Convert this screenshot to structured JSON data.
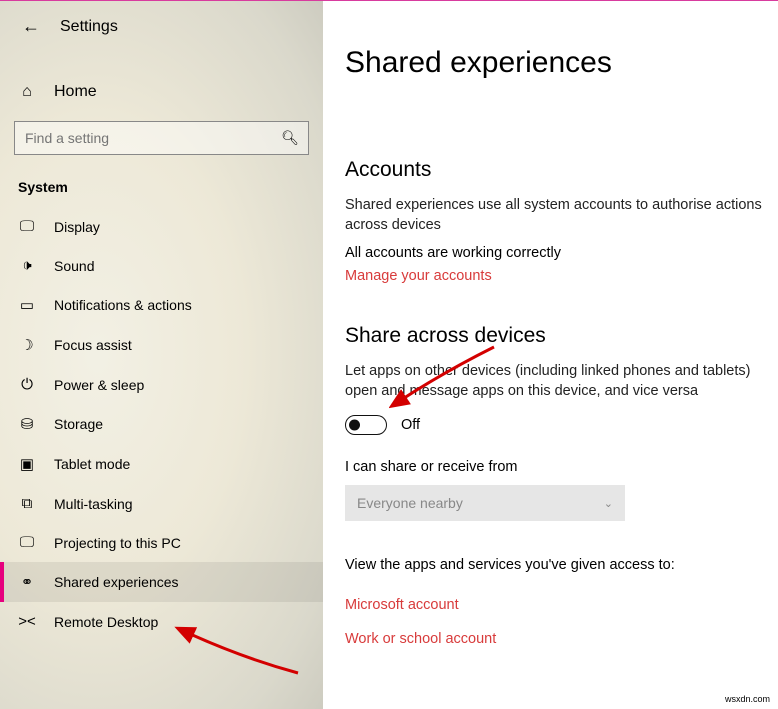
{
  "header": {
    "title": "Settings"
  },
  "home": {
    "label": "Home"
  },
  "search": {
    "placeholder": "Find a setting"
  },
  "section": "System",
  "nav": [
    {
      "label": "Display"
    },
    {
      "label": "Sound"
    },
    {
      "label": "Notifications & actions"
    },
    {
      "label": "Focus assist"
    },
    {
      "label": "Power & sleep"
    },
    {
      "label": "Storage"
    },
    {
      "label": "Tablet mode"
    },
    {
      "label": "Multi-tasking"
    },
    {
      "label": "Projecting to this PC"
    },
    {
      "label": "Shared experiences"
    },
    {
      "label": "Remote Desktop"
    }
  ],
  "page": {
    "title": "Shared experiences",
    "accounts": {
      "heading": "Accounts",
      "desc": "Shared experiences use all system accounts to authorise actions across devices",
      "status": "All accounts are working correctly",
      "manage": "Manage your accounts"
    },
    "share": {
      "heading": "Share across devices",
      "desc": "Let apps on other devices (including linked phones and tablets) open and message apps on this device, and vice versa",
      "toggle": "Off",
      "fromLabel": "I can share or receive from",
      "fromValue": "Everyone nearby"
    },
    "access": {
      "view": "View the apps and services you've given access to:",
      "ms": "Microsoft account",
      "work": "Work or school account"
    }
  },
  "watermark": "wsxdn.com"
}
